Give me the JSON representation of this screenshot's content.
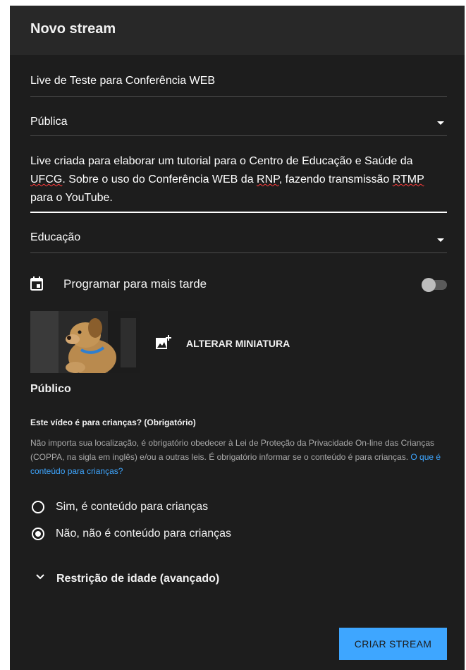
{
  "dialog": {
    "title": "Novo stream"
  },
  "form": {
    "title_value": "Live de Teste para Conferência WEB",
    "visibility_value": "Pública",
    "description": {
      "part1": "Live criada para elaborar um tutorial para o Centro de Educação e Saúde da ",
      "ufcg": "UFCG",
      "part2": ". Sobre o uso do Conferência WEB da ",
      "rnp": "RNP",
      "part3": ", fazendo transmissão ",
      "rtmp": "RTMP",
      "part4": " para o YouTube."
    },
    "category_value": "Educação"
  },
  "schedule": {
    "label": "Programar para mais tarde",
    "enabled": false
  },
  "thumbnail": {
    "change_label": "ALTERAR MINIATURA"
  },
  "audience": {
    "section_title": "Público",
    "question": "Este vídeo é para crianças? (Obrigatório)",
    "info": "Não importa sua localização, é obrigatório obedecer à Lei de Proteção da Privacidade On-line das Crianças (COPPA, na sigla em inglês) e/ou a outras leis. É obrigatório informar se o conteúdo é para crianças.",
    "info_link": "O que é conteúdo para crianças?",
    "options": [
      {
        "label": "Sim, é conteúdo para crianças",
        "selected": false
      },
      {
        "label": "Não, não é conteúdo para crianças",
        "selected": true
      }
    ]
  },
  "age_restriction": {
    "label": "Restrição de idade (avançado)"
  },
  "actions": {
    "create_label": "CRIAR STREAM"
  },
  "colors": {
    "background": "#1d1d1d",
    "header": "#282828",
    "accent": "#3ea6ff",
    "muted_text": "#aaaaaa"
  }
}
